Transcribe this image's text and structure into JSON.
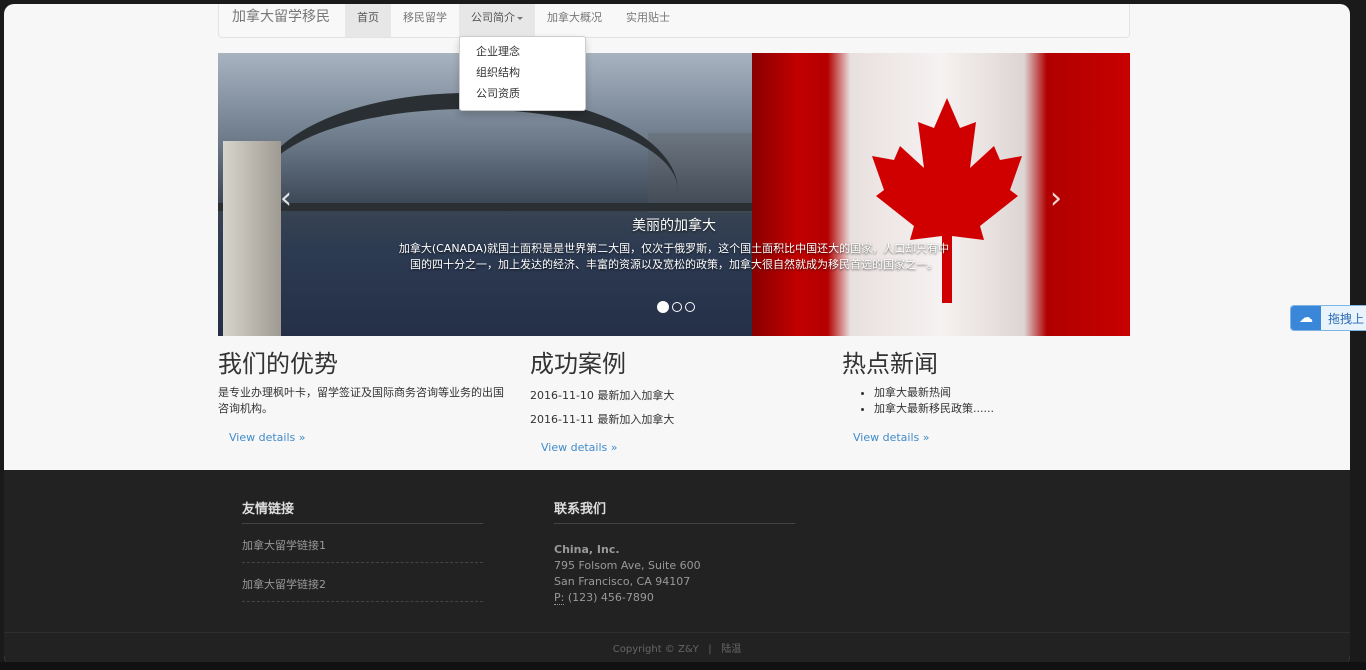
{
  "nav": {
    "brand": "加拿大留学移民",
    "items": [
      "首页",
      "移民留学",
      "公司简介",
      "加拿大概况",
      "实用贴士"
    ],
    "dropdown": [
      "企业理念",
      "组织结构",
      "公司资质"
    ]
  },
  "carousel": {
    "title": "美丽的加拿大",
    "text": "加拿大(CANADA)就国土面积是是世界第二大国，仅次于俄罗斯，这个国土面积比中国还大的国家，人口却只有中国的四十分之一，加上发达的经济、丰富的资源以及宽松的政策，加拿大很自然就成为移民首选的国家之一。",
    "prev": "‹",
    "next": "›"
  },
  "advantages": {
    "title": "我们的优势",
    "text": "是专业办理枫叶卡，留学签证及国际商务咨询等业务的出国咨询机构。",
    "link": "View details »"
  },
  "cases": {
    "title": "成功案例",
    "items": [
      "2016-11-10 最新加入加拿大",
      "2016-11-11 最新加入加拿大"
    ],
    "link": "View details »"
  },
  "news": {
    "title": "热点新闻",
    "items": [
      "加拿大最新热闻",
      "加拿大最新移民政策......"
    ],
    "link": "View details »"
  },
  "footer": {
    "links_title": "友情链接",
    "links": [
      "加拿大留学链接1",
      "加拿大留学链接2"
    ],
    "contact_title": "联系我们",
    "company": "China, Inc.",
    "address1": "795 Folsom Ave, Suite 600",
    "address2": "San Francisco, CA 94107",
    "phone_label": "P:",
    "phone": "(123) 456-7890",
    "copyright": "Copyright © Z&Y",
    "separator": "|",
    "extra": "陆温"
  },
  "widget": {
    "label": "拖拽上"
  }
}
